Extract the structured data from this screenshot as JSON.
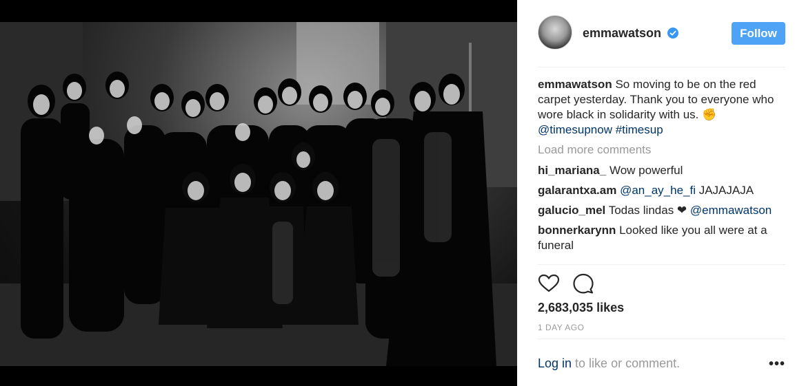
{
  "post": {
    "username": "emmawatson",
    "follow_label": "Follow",
    "caption_user": "emmawatson",
    "caption_text": "So moving to be on the red carpet yesterday. Thank you to everyone who wore black in solidarity with us. ✊",
    "caption_tags": "@timesupnow #timesup",
    "load_more": "Load more comments",
    "comments": [
      {
        "user": "hi_mariana_",
        "mention": "",
        "text": "Wow powerful"
      },
      {
        "user": "galarantxa.am",
        "mention": "@an_ay_he_fi",
        "text": "JAJAJAJA"
      },
      {
        "user": "galucio_mel",
        "mention": "",
        "text": "Todas lindas ❤",
        "mention_after": "@emmawatson"
      },
      {
        "user": "bonnerkarynn",
        "mention": "",
        "text": "Looked like you all were at a funeral"
      }
    ],
    "likes": "2,683,035 likes",
    "time": "1 DAY AGO",
    "login_link": "Log in",
    "login_rest": " to like or comment.",
    "more": "•••"
  },
  "icons": {
    "verified": "verified-badge-icon",
    "like": "heart-icon",
    "comment": "comment-bubble-icon",
    "more": "more-options-icon"
  },
  "colors": {
    "follow": "#4ea3f6",
    "link": "#003569",
    "muted": "#999999",
    "verified": "#3897f0"
  }
}
